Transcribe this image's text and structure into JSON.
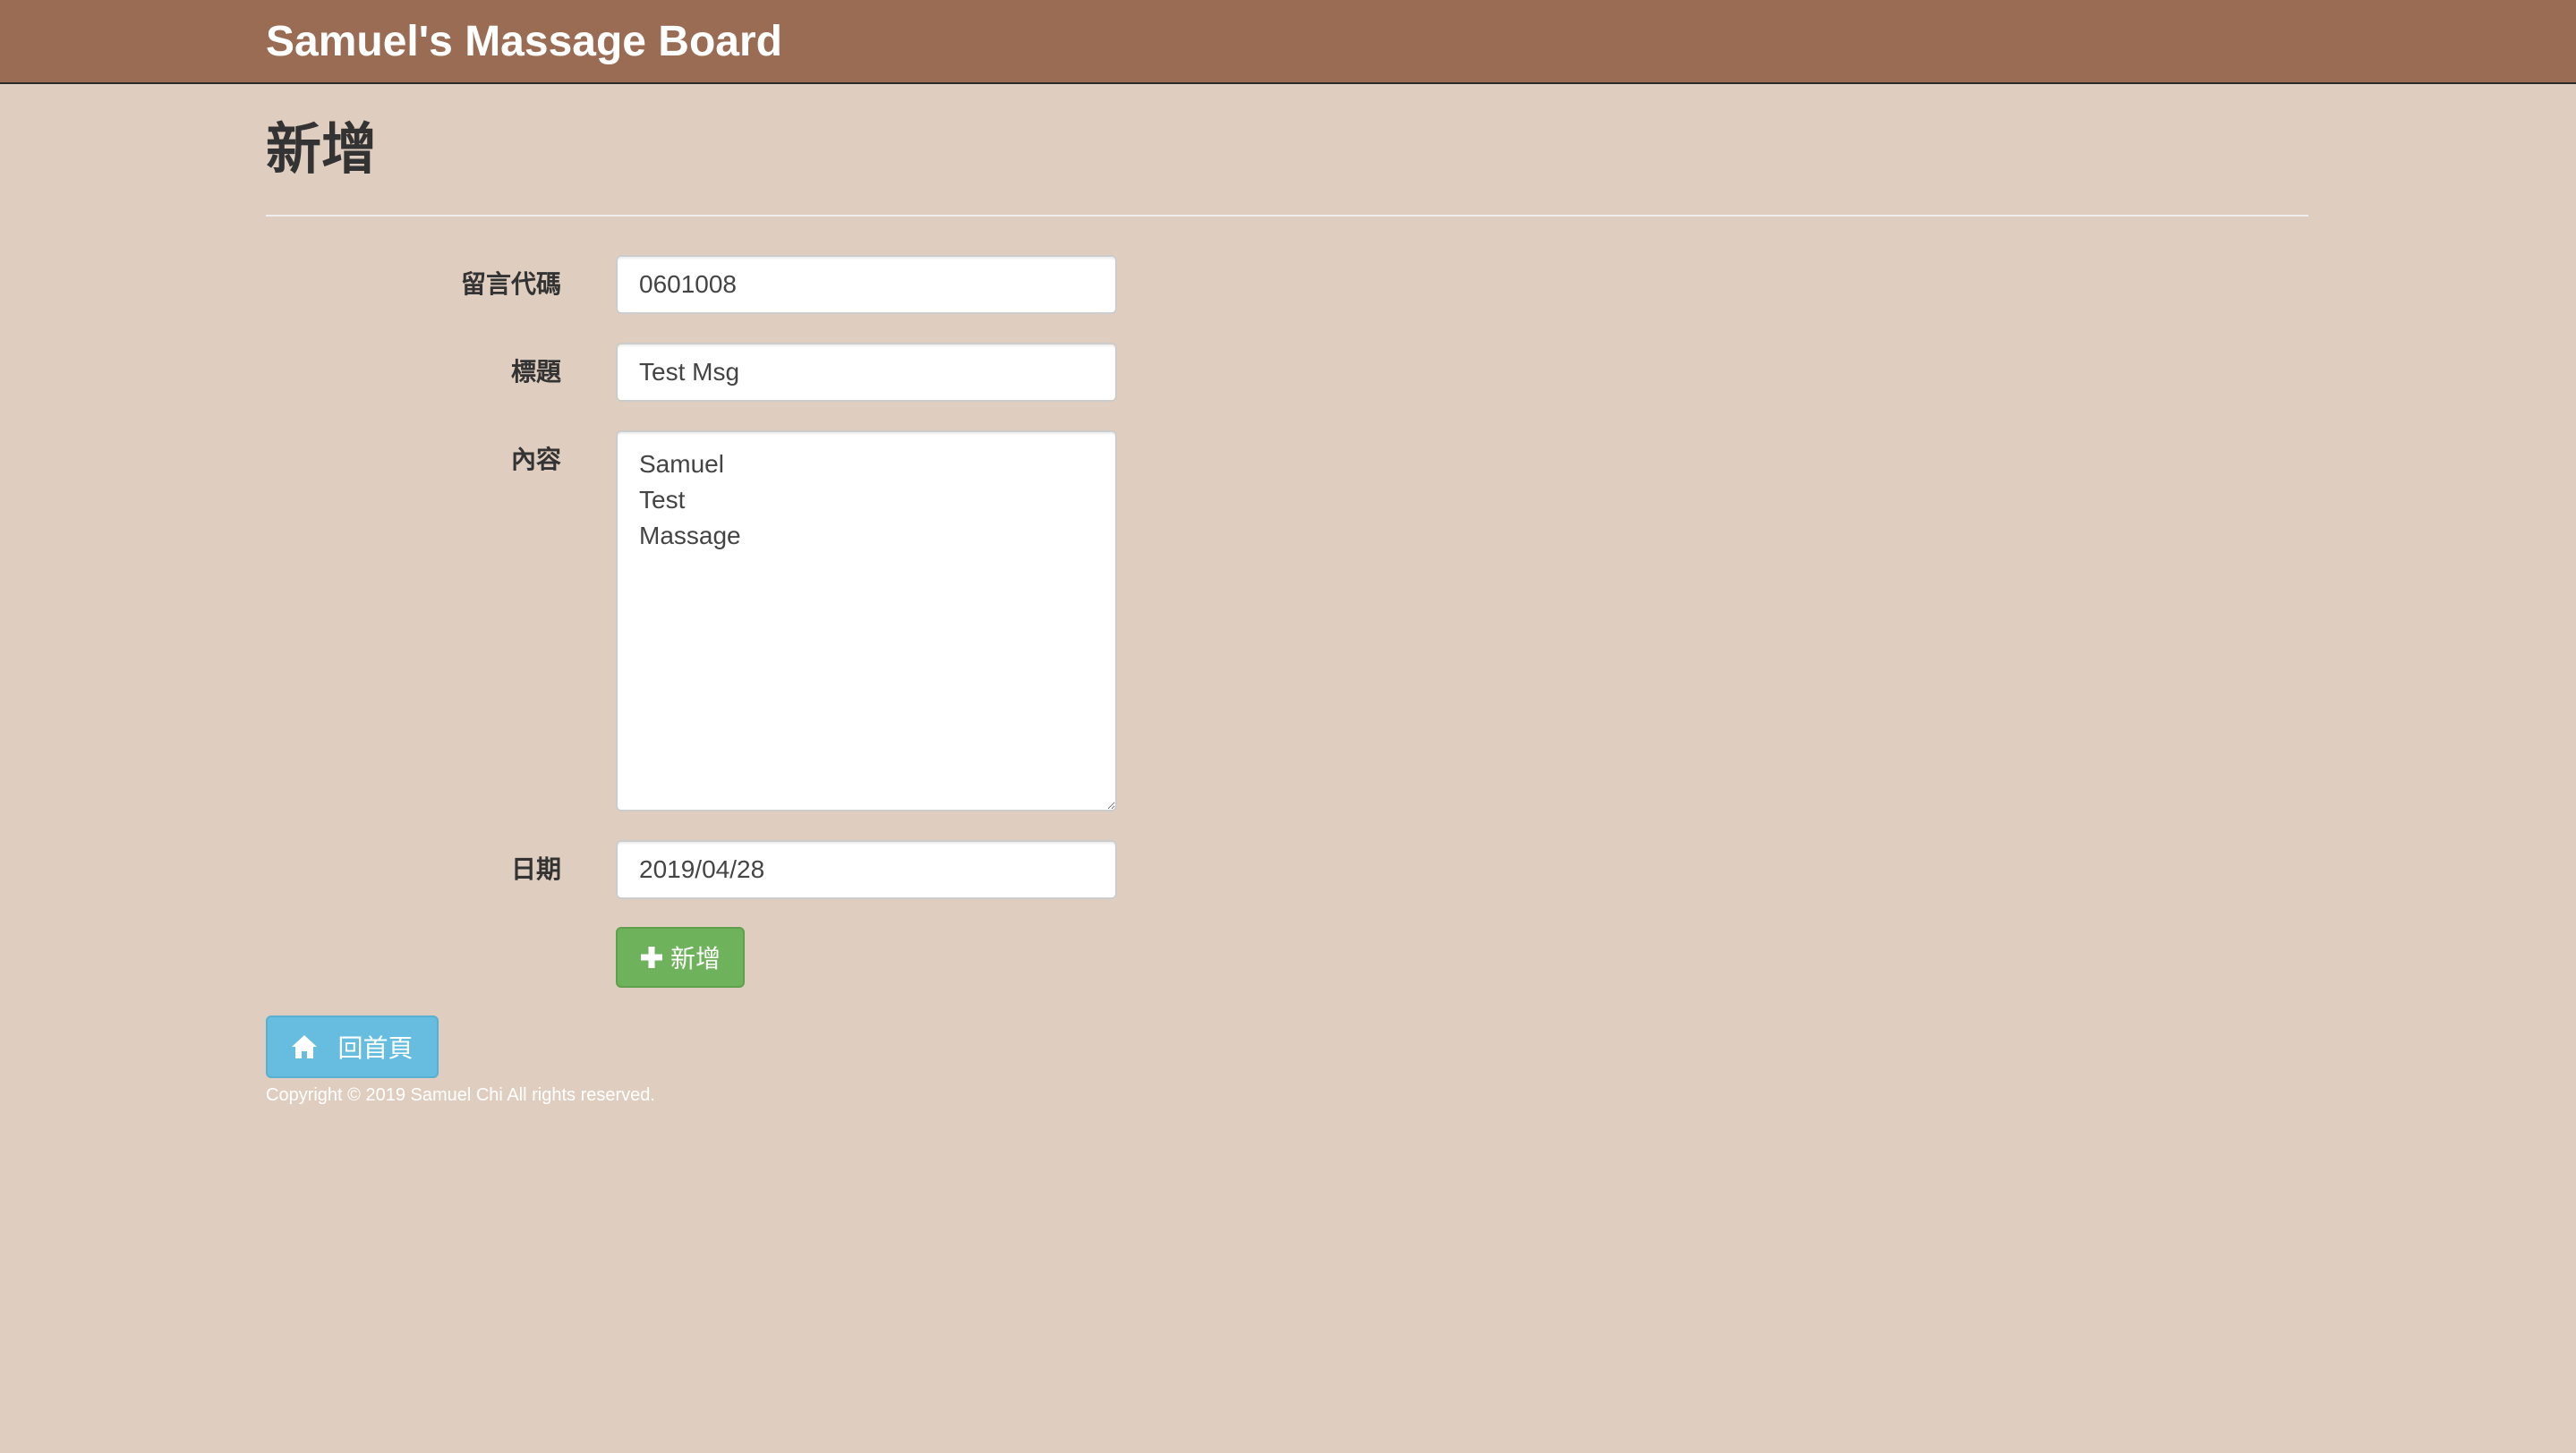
{
  "navbar": {
    "brand": "Samuel's Massage Board"
  },
  "page": {
    "title": "新增"
  },
  "form": {
    "message_id": {
      "label": "留言代碼",
      "value": "0601008"
    },
    "subject": {
      "label": "標題",
      "value": "Test Msg"
    },
    "content": {
      "label": "內容",
      "value": "Samuel\nTest\nMassage"
    },
    "date": {
      "label": "日期",
      "value": "2019/04/28"
    },
    "submit_label": "新增",
    "submit_icon": "plus-icon"
  },
  "home_button": {
    "label": "回首頁",
    "icon": "home-icon"
  },
  "footer": {
    "copyright": "Copyright © 2019 Samuel Chi All rights reserved."
  },
  "colors": {
    "background": "#dfcebf",
    "navbar": "#9a6c53",
    "success": "#6fb25c",
    "info": "#66bde0"
  }
}
